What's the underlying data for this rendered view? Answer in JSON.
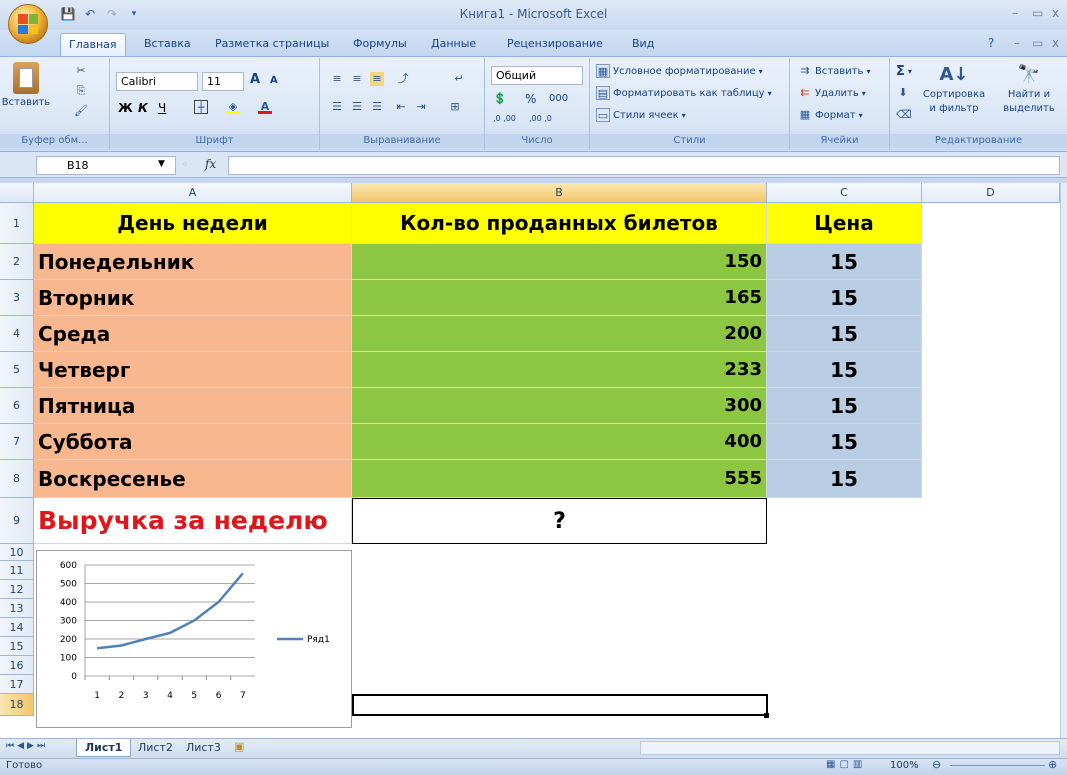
{
  "app": {
    "title": "Книга1 - Microsoft Excel",
    "window_controls": [
      "–",
      "▭",
      "x"
    ],
    "ribbon_controls": [
      "?",
      "–",
      "▭",
      "x"
    ]
  },
  "tabs": [
    "Главная",
    "Вставка",
    "Разметка страницы",
    "Формулы",
    "Данные",
    "Рецензирование",
    "Вид"
  ],
  "active_tab": 0,
  "ribbon": {
    "clipboard": {
      "paste": "Вставить",
      "label": "Буфер обм..."
    },
    "font": {
      "name": "Calibri",
      "size": "11",
      "bold": "Ж",
      "italic": "К",
      "underline": "Ч",
      "grow": "A",
      "shrink": "A",
      "label": "Шрифт"
    },
    "alignment": {
      "label": "Выравнивание"
    },
    "number": {
      "format": "Общий",
      "percent": "%",
      "thousands": "000",
      "inc": ",0 ,00",
      "dec": ",00 ,0",
      "label": "Число"
    },
    "styles": {
      "conditional": "Условное форматирование",
      "as_table": "Форматировать как таблицу",
      "cell_styles": "Стили ячеек",
      "label": "Стили"
    },
    "cells": {
      "insert": "Вставить",
      "delete": "Удалить",
      "format": "Формат",
      "label": "Ячейки"
    },
    "editing": {
      "sort_line1": "Сортировка",
      "sort_line2": "и фильтр",
      "find_line1": "Найти и",
      "find_line2": "выделить",
      "label": "Редактирование"
    }
  },
  "formula_bar": {
    "name_box": "B18",
    "fx": "fx",
    "value": ""
  },
  "columns": [
    "A",
    "B",
    "C",
    "D"
  ],
  "rows": [
    "1",
    "2",
    "3",
    "4",
    "5",
    "6",
    "7",
    "8",
    "9",
    "10",
    "11",
    "12",
    "13",
    "14",
    "15",
    "16",
    "17",
    "18"
  ],
  "table": {
    "header": {
      "a": "День недели",
      "b": "Кол-во проданных билетов",
      "c": "Цена"
    },
    "data": [
      {
        "day": "Понедельник",
        "tickets": "150",
        "price": "15"
      },
      {
        "day": "Вторник",
        "tickets": "165",
        "price": "15"
      },
      {
        "day": "Среда",
        "tickets": "200",
        "price": "15"
      },
      {
        "day": "Четверг",
        "tickets": "233",
        "price": "15"
      },
      {
        "day": "Пятница",
        "tickets": "300",
        "price": "15"
      },
      {
        "day": "Суббота",
        "tickets": "400",
        "price": "15"
      },
      {
        "day": "Воскресенье",
        "tickets": "555",
        "price": "15"
      }
    ],
    "revenue_label": "Выручка за неделю",
    "revenue_value": "?"
  },
  "colors": {
    "header_fill": "#ffff00",
    "day_fill": "#f9b78f",
    "tickets_fill": "#8dc641",
    "price_fill": "#b8cce4",
    "revenue_text": "#e0171a",
    "series_line": "#4f81bd"
  },
  "chart_data": {
    "type": "line",
    "x": [
      1,
      2,
      3,
      4,
      5,
      6,
      7
    ],
    "series": [
      {
        "name": "Ряд1",
        "values": [
          150,
          165,
          200,
          233,
          300,
          400,
          555
        ]
      }
    ],
    "yticks": [
      "0",
      "100",
      "200",
      "300",
      "400",
      "500",
      "600"
    ],
    "xticks": [
      "1",
      "2",
      "3",
      "4",
      "5",
      "6",
      "7"
    ],
    "ylim": [
      0,
      600
    ],
    "grid": true,
    "legend": "right"
  },
  "sheets": [
    "Лист1",
    "Лист2",
    "Лист3"
  ],
  "active_sheet": 0,
  "status": {
    "ready": "Готово",
    "zoom": "100%"
  }
}
